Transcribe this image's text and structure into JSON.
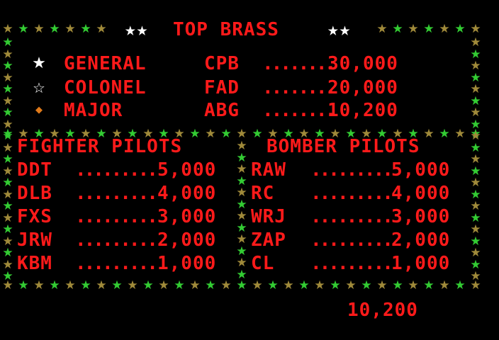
{
  "title": {
    "stars_left": "★★",
    "text": "TOP BRASS",
    "stars_right": "★★"
  },
  "colors": {
    "text": "#ff1a1a",
    "star_green": "#33cc33",
    "star_olive": "#a08a3a",
    "title_stars": "#ffffff",
    "icon_general": "#ffffff",
    "icon_colonel": "#ffffff",
    "icon_major": "#e07a1a"
  },
  "top_brass": [
    {
      "icon": "white-star-icon",
      "rank": "GENERAL",
      "initials": "CPB",
      "dots": "........",
      "score": "30,000"
    },
    {
      "icon": "outlined-star-icon",
      "rank": "COLONEL",
      "initials": "FAD",
      "dots": "........",
      "score": "20,000"
    },
    {
      "icon": "orange-badge-icon",
      "rank": "MAJOR",
      "initials": "ABG",
      "dots": "........",
      "score": "10,200"
    }
  ],
  "fighter_pilots": {
    "header": "FIGHTER PILOTS",
    "entries": [
      {
        "initials": "DDT",
        "dots": ".........",
        "score": "5,000"
      },
      {
        "initials": "DLB",
        "dots": ".........",
        "score": "4,000"
      },
      {
        "initials": "FXS",
        "dots": ".........",
        "score": "3,000"
      },
      {
        "initials": "JRW",
        "dots": ".........",
        "score": "2,000"
      },
      {
        "initials": "KBM",
        "dots": ".........",
        "score": "1,000"
      }
    ]
  },
  "bomber_pilots": {
    "header": "BOMBER PILOTS",
    "entries": [
      {
        "initials": "RAW",
        "dots": ".........",
        "score": "5,000"
      },
      {
        "initials": "RC",
        "dots": ".........",
        "score": "4,000"
      },
      {
        "initials": "WRJ",
        "dots": ".........",
        "score": "3,000"
      },
      {
        "initials": "ZAP",
        "dots": ".........",
        "score": "2,000"
      },
      {
        "initials": "CL",
        "dots": ".........",
        "score": "1,000"
      }
    ]
  },
  "current_score": "10,200"
}
